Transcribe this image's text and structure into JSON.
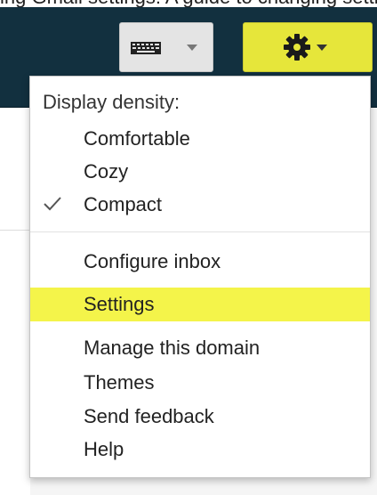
{
  "page": {
    "cropped_title": "ing Gmail settings: A guide to changing settings"
  },
  "toolbar": {
    "keyboard_button": {
      "icon": "keyboard-icon",
      "chevron": "chevron-down-icon"
    },
    "settings_button": {
      "icon": "gear-icon",
      "chevron": "chevron-down-icon",
      "color": "#e6e63a"
    }
  },
  "menu": {
    "heading": "Display density:",
    "density_options": [
      {
        "label": "Comfortable",
        "checked": false
      },
      {
        "label": "Cozy",
        "checked": false
      },
      {
        "label": "Compact",
        "checked": true
      }
    ],
    "configure_inbox": "Configure inbox",
    "items": [
      {
        "label": "Settings",
        "highlighted": true
      },
      {
        "label": "Manage this domain",
        "highlighted": false
      },
      {
        "label": "Themes",
        "highlighted": false
      },
      {
        "label": "Send feedback",
        "highlighted": false
      },
      {
        "label": "Help",
        "highlighted": false
      }
    ],
    "highlight_color": "#f4f44a"
  }
}
